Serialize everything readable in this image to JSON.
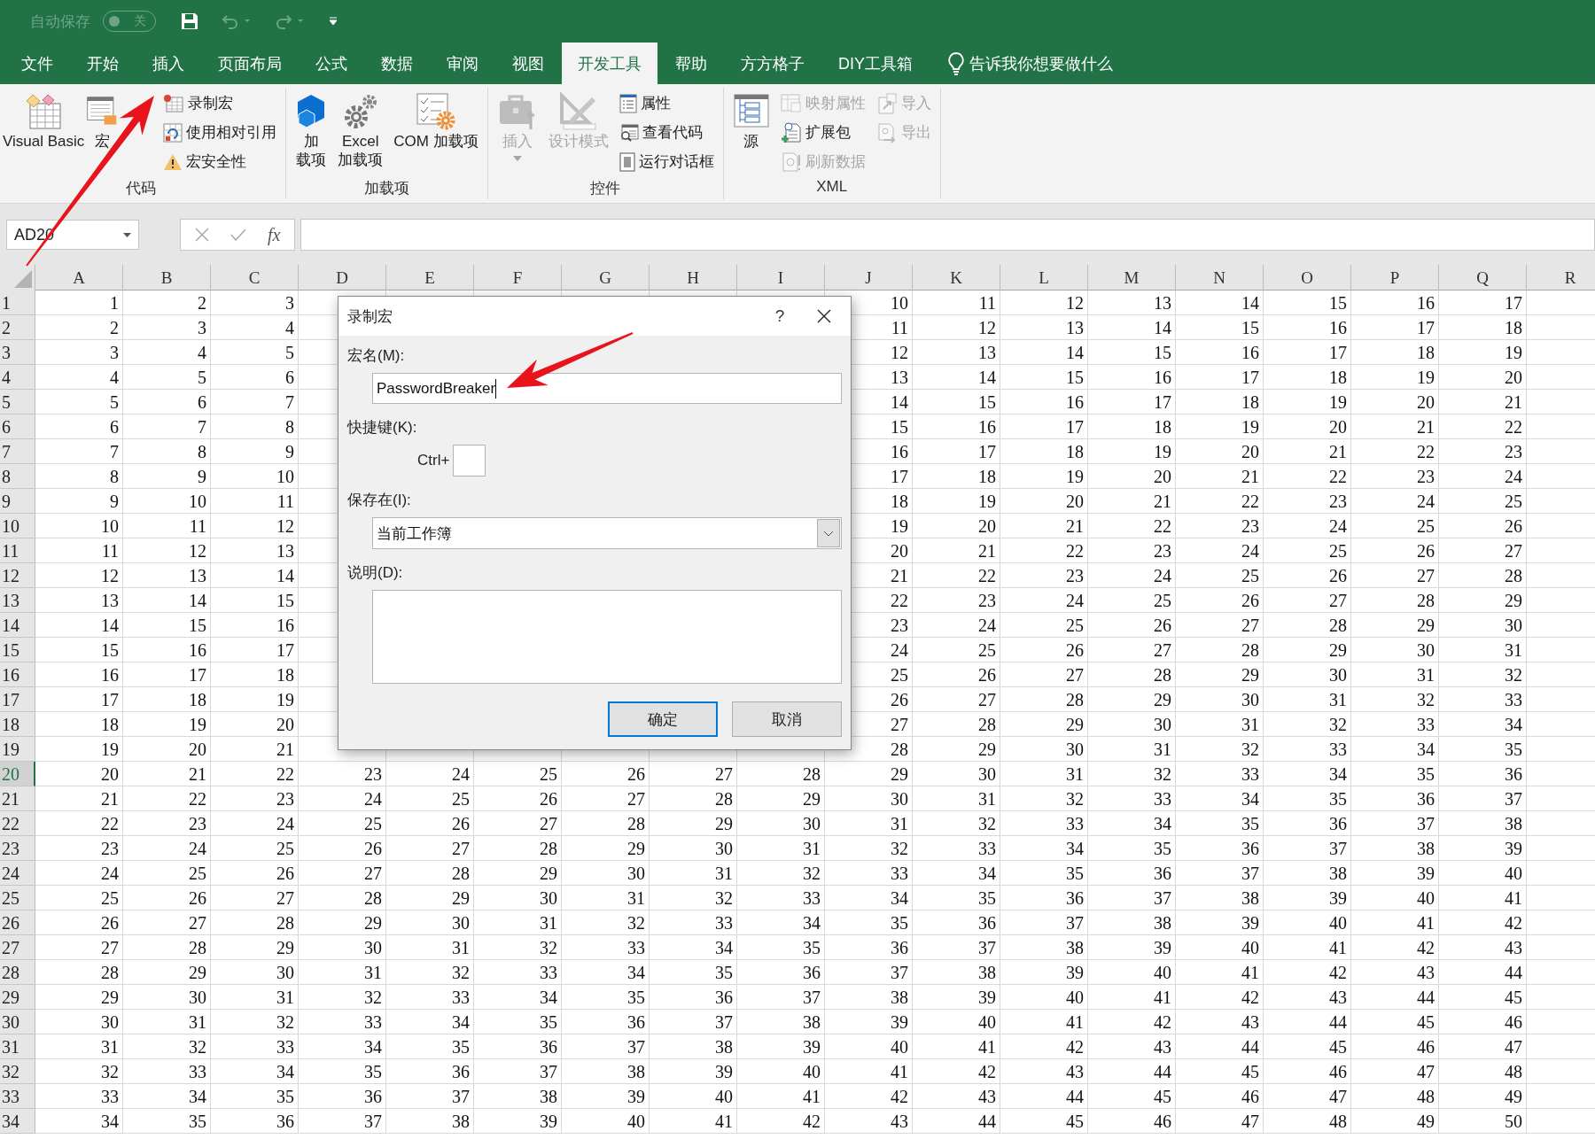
{
  "title_bar": {
    "autosave_label": "自动保存",
    "autosave_toggle": {
      "label": "关",
      "on": false
    }
  },
  "tabs": [
    {
      "label": "文件",
      "selected": false
    },
    {
      "label": "开始",
      "selected": false
    },
    {
      "label": "插入",
      "selected": false
    },
    {
      "label": "页面布局",
      "selected": false
    },
    {
      "label": "公式",
      "selected": false
    },
    {
      "label": "数据",
      "selected": false
    },
    {
      "label": "审阅",
      "selected": false
    },
    {
      "label": "视图",
      "selected": false
    },
    {
      "label": "开发工具",
      "selected": true
    },
    {
      "label": "帮助",
      "selected": false
    },
    {
      "label": "方方格子",
      "selected": false
    },
    {
      "label": "DIY工具箱",
      "selected": false
    }
  ],
  "tell_me": "告诉我你想要做什么",
  "ribbon": {
    "groups": [
      {
        "label": "代码",
        "items": [
          {
            "kind": "large",
            "lines": [
              "Visual Basic"
            ],
            "disabled": false,
            "dropdown": false
          },
          {
            "kind": "large",
            "lines": [
              "宏"
            ],
            "disabled": false,
            "dropdown": false
          },
          {
            "kind": "stack",
            "entries": [
              {
                "label": "录制宏",
                "disabled": false
              },
              {
                "label": "使用相对引用",
                "disabled": false
              },
              {
                "label": "宏安全性",
                "disabled": false
              }
            ]
          }
        ]
      },
      {
        "label": "加载项",
        "items": [
          {
            "kind": "large",
            "lines": [
              "加",
              "载项"
            ],
            "disabled": false,
            "dropdown": false
          },
          {
            "kind": "large",
            "lines": [
              "Excel",
              "加载项"
            ],
            "disabled": false,
            "dropdown": false
          },
          {
            "kind": "large",
            "lines": [
              "COM 加载项"
            ],
            "disabled": false,
            "dropdown": false
          }
        ]
      },
      {
        "label": "控件",
        "items": [
          {
            "kind": "large",
            "lines": [
              "插入"
            ],
            "disabled": true,
            "dropdown": true
          },
          {
            "kind": "large",
            "lines": [
              "设计模式"
            ],
            "disabled": true,
            "dropdown": false
          },
          {
            "kind": "stack",
            "entries": [
              {
                "label": "属性",
                "disabled": false
              },
              {
                "label": "查看代码",
                "disabled": false
              },
              {
                "label": "运行对话框",
                "disabled": false
              }
            ]
          }
        ]
      },
      {
        "label": "XML",
        "items": [
          {
            "kind": "large",
            "lines": [
              "源"
            ],
            "disabled": false,
            "dropdown": false
          },
          {
            "kind": "stack",
            "entries": [
              {
                "label": "映射属性",
                "disabled": true
              },
              {
                "label": "扩展包",
                "disabled": false
              },
              {
                "label": "刷新数据",
                "disabled": true
              }
            ]
          },
          {
            "kind": "stack",
            "entries": [
              {
                "label": "导入",
                "disabled": true
              },
              {
                "label": "导出",
                "disabled": true
              }
            ]
          }
        ]
      }
    ]
  },
  "formula_bar": {
    "name_box": "AD20",
    "function_button": "fx"
  },
  "sheet": {
    "columns": [
      "A",
      "B",
      "C",
      "D",
      "E",
      "F",
      "G",
      "H",
      "I",
      "J",
      "K",
      "L",
      "M",
      "N",
      "O",
      "P",
      "Q",
      "R"
    ],
    "rows": [
      {
        "header": "1",
        "selected": false,
        "cells": [
          "1",
          "2",
          "3",
          null,
          null,
          null,
          null,
          null,
          null,
          "10",
          "11",
          "12",
          "13",
          "14",
          "15",
          "16",
          "17"
        ]
      },
      {
        "header": "2",
        "selected": false,
        "cells": [
          "2",
          "3",
          "4",
          null,
          null,
          null,
          null,
          null,
          null,
          "11",
          "12",
          "13",
          "14",
          "15",
          "16",
          "17",
          "18"
        ]
      },
      {
        "header": "3",
        "selected": false,
        "cells": [
          "3",
          "4",
          "5",
          null,
          null,
          null,
          null,
          null,
          null,
          "12",
          "13",
          "14",
          "15",
          "16",
          "17",
          "18",
          "19"
        ]
      },
      {
        "header": "4",
        "selected": false,
        "cells": [
          "4",
          "5",
          "6",
          null,
          null,
          null,
          null,
          null,
          null,
          "13",
          "14",
          "15",
          "16",
          "17",
          "18",
          "19",
          "20"
        ]
      },
      {
        "header": "5",
        "selected": false,
        "cells": [
          "5",
          "6",
          "7",
          null,
          null,
          null,
          null,
          null,
          null,
          "14",
          "15",
          "16",
          "17",
          "18",
          "19",
          "20",
          "21"
        ]
      },
      {
        "header": "6",
        "selected": false,
        "cells": [
          "6",
          "7",
          "8",
          null,
          null,
          null,
          null,
          null,
          null,
          "15",
          "16",
          "17",
          "18",
          "19",
          "20",
          "21",
          "22"
        ]
      },
      {
        "header": "7",
        "selected": false,
        "cells": [
          "7",
          "8",
          "9",
          null,
          null,
          null,
          null,
          null,
          null,
          "16",
          "17",
          "18",
          "19",
          "20",
          "21",
          "22",
          "23"
        ]
      },
      {
        "header": "8",
        "selected": false,
        "cells": [
          "8",
          "9",
          "10",
          null,
          null,
          null,
          null,
          null,
          null,
          "17",
          "18",
          "19",
          "20",
          "21",
          "22",
          "23",
          "24"
        ]
      },
      {
        "header": "9",
        "selected": false,
        "cells": [
          "9",
          "10",
          "11",
          null,
          null,
          null,
          null,
          null,
          null,
          "18",
          "19",
          "20",
          "21",
          "22",
          "23",
          "24",
          "25"
        ]
      },
      {
        "header": "10",
        "selected": false,
        "cells": [
          "10",
          "11",
          "12",
          null,
          null,
          null,
          null,
          null,
          null,
          "19",
          "20",
          "21",
          "22",
          "23",
          "24",
          "25",
          "26"
        ]
      },
      {
        "header": "11",
        "selected": false,
        "cells": [
          "11",
          "12",
          "13",
          null,
          null,
          null,
          null,
          null,
          null,
          "20",
          "21",
          "22",
          "23",
          "24",
          "25",
          "26",
          "27"
        ]
      },
      {
        "header": "12",
        "selected": false,
        "cells": [
          "12",
          "13",
          "14",
          null,
          null,
          null,
          null,
          null,
          null,
          "21",
          "22",
          "23",
          "24",
          "25",
          "26",
          "27",
          "28"
        ]
      },
      {
        "header": "13",
        "selected": false,
        "cells": [
          "13",
          "14",
          "15",
          null,
          null,
          null,
          null,
          null,
          null,
          "22",
          "23",
          "24",
          "25",
          "26",
          "27",
          "28",
          "29"
        ]
      },
      {
        "header": "14",
        "selected": false,
        "cells": [
          "14",
          "15",
          "16",
          null,
          null,
          null,
          null,
          null,
          null,
          "23",
          "24",
          "25",
          "26",
          "27",
          "28",
          "29",
          "30"
        ]
      },
      {
        "header": "15",
        "selected": false,
        "cells": [
          "15",
          "16",
          "17",
          null,
          null,
          null,
          null,
          null,
          null,
          "24",
          "25",
          "26",
          "27",
          "28",
          "29",
          "30",
          "31"
        ]
      },
      {
        "header": "16",
        "selected": false,
        "cells": [
          "16",
          "17",
          "18",
          null,
          null,
          null,
          null,
          null,
          null,
          "25",
          "26",
          "27",
          "28",
          "29",
          "30",
          "31",
          "32"
        ]
      },
      {
        "header": "17",
        "selected": false,
        "cells": [
          "17",
          "18",
          "19",
          null,
          null,
          null,
          null,
          null,
          null,
          "26",
          "27",
          "28",
          "29",
          "30",
          "31",
          "32",
          "33"
        ]
      },
      {
        "header": "18",
        "selected": false,
        "cells": [
          "18",
          "19",
          "20",
          null,
          null,
          null,
          null,
          null,
          null,
          "27",
          "28",
          "29",
          "30",
          "31",
          "32",
          "33",
          "34"
        ]
      },
      {
        "header": "19",
        "selected": false,
        "cells": [
          "19",
          "20",
          "21",
          null,
          null,
          null,
          null,
          null,
          null,
          "28",
          "29",
          "30",
          "31",
          "32",
          "33",
          "34",
          "35"
        ]
      },
      {
        "header": "20",
        "selected": true,
        "cells": [
          "20",
          "21",
          "22",
          "23",
          "24",
          "25",
          "26",
          "27",
          "28",
          "29",
          "30",
          "31",
          "32",
          "33",
          "34",
          "35",
          "36"
        ]
      },
      {
        "header": "21",
        "selected": false,
        "cells": [
          "21",
          "22",
          "23",
          "24",
          "25",
          "26",
          "27",
          "28",
          "29",
          "30",
          "31",
          "32",
          "33",
          "34",
          "35",
          "36",
          "37"
        ]
      },
      {
        "header": "22",
        "selected": false,
        "cells": [
          "22",
          "23",
          "24",
          "25",
          "26",
          "27",
          "28",
          "29",
          "30",
          "31",
          "32",
          "33",
          "34",
          "35",
          "36",
          "37",
          "38"
        ]
      },
      {
        "header": "23",
        "selected": false,
        "cells": [
          "23",
          "24",
          "25",
          "26",
          "27",
          "28",
          "29",
          "30",
          "31",
          "32",
          "33",
          "34",
          "35",
          "36",
          "37",
          "38",
          "39"
        ]
      },
      {
        "header": "24",
        "selected": false,
        "cells": [
          "24",
          "25",
          "26",
          "27",
          "28",
          "29",
          "30",
          "31",
          "32",
          "33",
          "34",
          "35",
          "36",
          "37",
          "38",
          "39",
          "40"
        ]
      },
      {
        "header": "25",
        "selected": false,
        "cells": [
          "25",
          "26",
          "27",
          "28",
          "29",
          "30",
          "31",
          "32",
          "33",
          "34",
          "35",
          "36",
          "37",
          "38",
          "39",
          "40",
          "41"
        ]
      },
      {
        "header": "26",
        "selected": false,
        "cells": [
          "26",
          "27",
          "28",
          "29",
          "30",
          "31",
          "32",
          "33",
          "34",
          "35",
          "36",
          "37",
          "38",
          "39",
          "40",
          "41",
          "42"
        ]
      },
      {
        "header": "27",
        "selected": false,
        "cells": [
          "27",
          "28",
          "29",
          "30",
          "31",
          "32",
          "33",
          "34",
          "35",
          "36",
          "37",
          "38",
          "39",
          "40",
          "41",
          "42",
          "43"
        ]
      },
      {
        "header": "28",
        "selected": false,
        "cells": [
          "28",
          "29",
          "30",
          "31",
          "32",
          "33",
          "34",
          "35",
          "36",
          "37",
          "38",
          "39",
          "40",
          "41",
          "42",
          "43",
          "44"
        ]
      },
      {
        "header": "29",
        "selected": false,
        "cells": [
          "29",
          "30",
          "31",
          "32",
          "33",
          "34",
          "35",
          "36",
          "37",
          "38",
          "39",
          "40",
          "41",
          "42",
          "43",
          "44",
          "45"
        ]
      },
      {
        "header": "30",
        "selected": false,
        "cells": [
          "30",
          "31",
          "32",
          "33",
          "34",
          "35",
          "36",
          "37",
          "38",
          "39",
          "40",
          "41",
          "42",
          "43",
          "44",
          "45",
          "46"
        ]
      },
      {
        "header": "31",
        "selected": false,
        "cells": [
          "31",
          "32",
          "33",
          "34",
          "35",
          "36",
          "37",
          "38",
          "39",
          "40",
          "41",
          "42",
          "43",
          "44",
          "45",
          "46",
          "47"
        ]
      },
      {
        "header": "32",
        "selected": false,
        "cells": [
          "32",
          "33",
          "34",
          "35",
          "36",
          "37",
          "38",
          "39",
          "40",
          "41",
          "42",
          "43",
          "44",
          "45",
          "46",
          "47",
          "48"
        ]
      },
      {
        "header": "33",
        "selected": false,
        "cells": [
          "33",
          "34",
          "35",
          "36",
          "37",
          "38",
          "39",
          "40",
          "41",
          "42",
          "43",
          "44",
          "45",
          "46",
          "47",
          "48",
          "49"
        ]
      },
      {
        "header": "34",
        "selected": false,
        "cells": [
          "34",
          "35",
          "36",
          "37",
          "38",
          "39",
          "40",
          "41",
          "42",
          "43",
          "44",
          "45",
          "46",
          "47",
          "48",
          "49",
          "50"
        ]
      }
    ]
  },
  "dialog": {
    "title": "录制宏",
    "help_button": "?",
    "name_label": "宏名(M):",
    "name_value": "PasswordBreaker",
    "shortcut_label": "快捷键(K):",
    "shortcut_prefix": "Ctrl+",
    "store_label": "保存在(I):",
    "store_value": "当前工作簿",
    "description_label": "说明(D):",
    "buttons": [
      {
        "label": "确定",
        "default": true
      },
      {
        "label": "取消",
        "default": false
      }
    ]
  }
}
